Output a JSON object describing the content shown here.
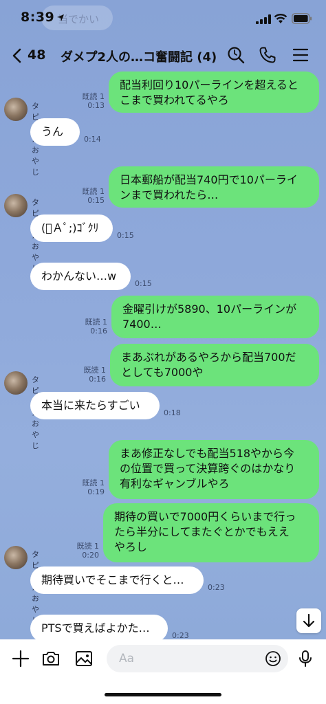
{
  "status_bar": {
    "time": "8:39",
    "ghost_text": "当でかい"
  },
  "header": {
    "back_count": "48",
    "title": "ダメプ2人の…コ奮闘記 (4)",
    "icons": [
      "search-icon",
      "phone-icon",
      "menu-icon"
    ]
  },
  "messages": [
    {
      "side": "me",
      "lines": [
        "配当利回り10パーラインを超えると",
        "こまで買われてるやろ"
      ],
      "read": "既読 1",
      "time": "0:13"
    },
    {
      "side": "other",
      "sender": "タピオカおやじ",
      "lines": [
        "うん"
      ],
      "time": "0:14"
    },
    {
      "side": "me",
      "lines": [
        "日本郵船が配当740円で10パーライ",
        "ンまで買われたら…"
      ],
      "read": "既読 1",
      "time": "0:15"
    },
    {
      "side": "other",
      "sender": "タピオカおやじ",
      "lines": [
        "(ﾟＡﾟ;)ｺﾞｸﾘ"
      ],
      "time": "0:15"
    },
    {
      "side": "other",
      "lines": [
        "わかんない…w"
      ],
      "time": "0:15"
    },
    {
      "side": "me",
      "lines": [
        "金曜引けが5890、10パーラインが",
        "7400…"
      ],
      "read": "既読 1",
      "time": "0:16"
    },
    {
      "side": "me",
      "lines": [
        "まあぶれがあるやろから配当700だ",
        "としても7000や"
      ],
      "read": "既読 1",
      "time": "0:16"
    },
    {
      "side": "other",
      "sender": "タピオカおやじ",
      "lines": [
        "本当に来たらすごい"
      ],
      "time": "0:18"
    },
    {
      "side": "me",
      "lines": [
        "まあ修正なしでも配当518やから今",
        "の位置で買って決算跨ぐのはかなり",
        "有利なギャンブルやろ"
      ],
      "read": "既読 1",
      "time": "0:19"
    },
    {
      "side": "me",
      "lines": [
        "期待の買いで7000円くらいまで行っ",
        "たら半分にしてまたぐとかでもええ",
        "やろし"
      ],
      "read": "既読 1",
      "time": "0:20"
    },
    {
      "side": "other",
      "sender": "タピオカおやじ",
      "lines": [
        "期待買いでそこまで行くと…"
      ],
      "time": "0:23"
    },
    {
      "side": "other",
      "lines": [
        "PTSで買えばよかた…"
      ],
      "time": "0:23"
    }
  ],
  "input": {
    "placeholder": "Aa",
    "icons": [
      "plus-icon",
      "camera-icon",
      "image-icon",
      "emoji-icon",
      "mic-icon"
    ]
  }
}
